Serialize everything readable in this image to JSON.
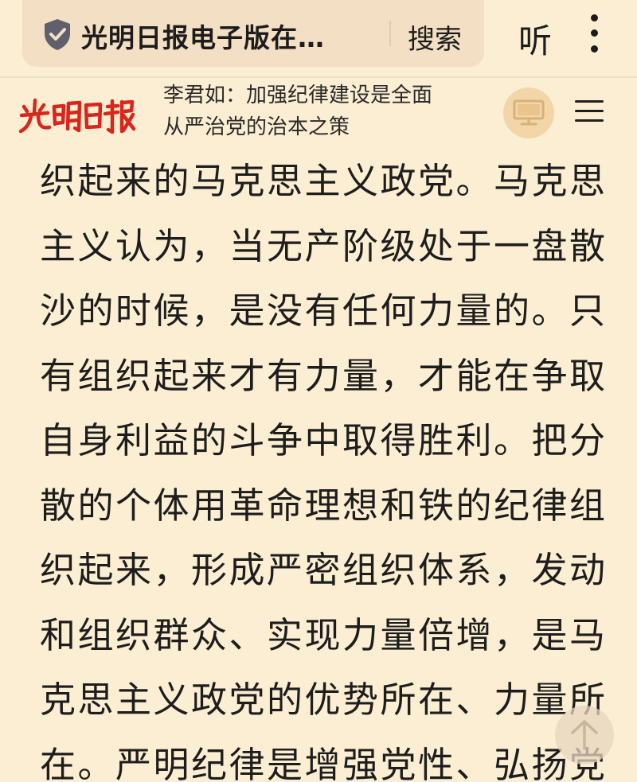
{
  "browser": {
    "url_title": "光明日报电子版在…",
    "search_label": "搜索",
    "listen_label": "听",
    "menu_icon": "more-vertical-icon",
    "security_icon": "shield-check-icon"
  },
  "site": {
    "logo_text": "光明日报",
    "headline_line1": "李君如：加强纪律建设是全面",
    "headline_line2": "从严治党的治本之策",
    "desktop_icon": "monitor-icon",
    "menu_icon": "hamburger-menu-icon"
  },
  "article": {
    "lines": [
      "织起来的马克思主义政党。马克思",
      "主义认为，当无产阶级处于一盘散",
      "沙的时候，是没有任何力量的。只",
      "有组织起来才有力量，才能在争取",
      "自身利益的斗争中取得胜利。把分",
      "散的个体用革命理想和铁的纪律组",
      "织起来，形成严密组织体系，发动",
      "和组织群众、实现力量倍增，是马",
      "克思主义政党的优势所在、力量所",
      "在。严明纪律是增强党性、弘扬党"
    ]
  },
  "colors": {
    "background": "#fbeed2",
    "pill": "#f3dfc3",
    "logo_red": "#d9261c",
    "shield_grey": "#5f5f6d"
  },
  "scroll_top_icon": "arrow-up-icon"
}
